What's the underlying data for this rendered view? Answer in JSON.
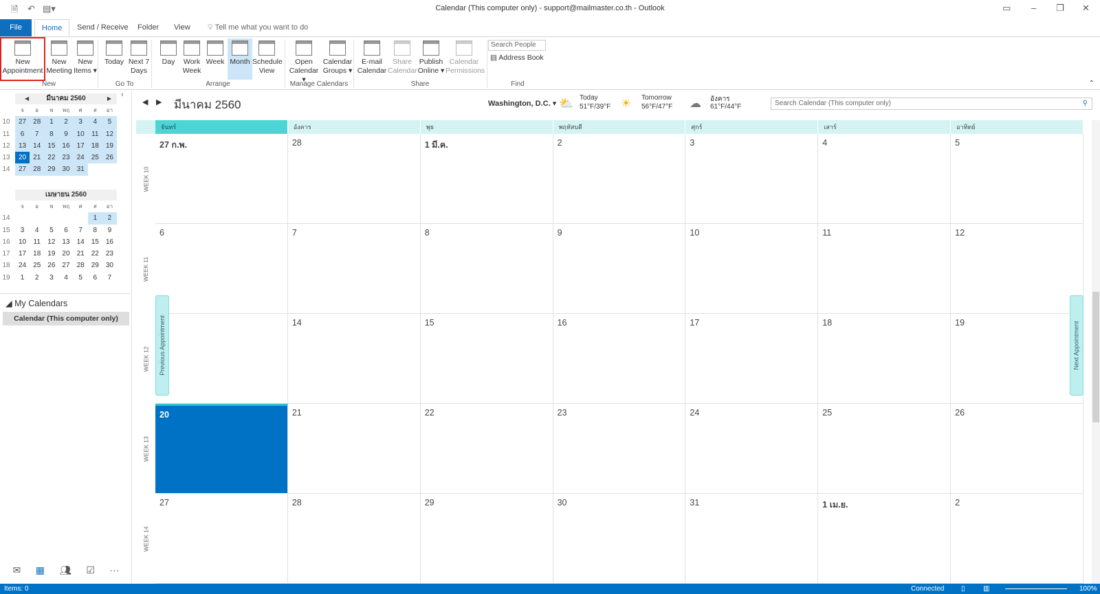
{
  "window": {
    "title": "Calendar (This computer only) - support@mailmaster.co.th  -  Outlook"
  },
  "tabs": [
    {
      "label": "File"
    },
    {
      "label": "Home"
    },
    {
      "label": "Send / Receive"
    },
    {
      "label": "Folder"
    },
    {
      "label": "View"
    }
  ],
  "tell_me": "Tell me what you want to do",
  "ribbon": {
    "buttons": [
      {
        "label": "New Appointment",
        "icon": "calendar-new-icon"
      },
      {
        "label": "New Meeting",
        "icon": "meeting-icon"
      },
      {
        "label": "New Items ▾",
        "icon": "new-items-icon"
      },
      {
        "label": "Today",
        "icon": "today-icon"
      },
      {
        "label": "Next 7 Days",
        "icon": "next-7-days-icon"
      },
      {
        "label": "Day",
        "icon": "day-view-icon"
      },
      {
        "label": "Work Week",
        "icon": "work-week-icon"
      },
      {
        "label": "Week",
        "icon": "week-view-icon"
      },
      {
        "label": "Month",
        "icon": "month-view-icon"
      },
      {
        "label": "Schedule View",
        "icon": "schedule-view-icon"
      },
      {
        "label": "Open Calendar ▾",
        "icon": "open-calendar-icon"
      },
      {
        "label": "Calendar Groups ▾",
        "icon": "calendar-groups-icon"
      },
      {
        "label": "E-mail Calendar",
        "icon": "email-calendar-icon"
      },
      {
        "label": "Share Calendar",
        "icon": "share-calendar-icon"
      },
      {
        "label": "Publish Online ▾",
        "icon": "publish-online-icon"
      },
      {
        "label": "Calendar Permissions",
        "icon": "permissions-icon"
      }
    ],
    "groups": [
      "New",
      "Go To",
      "Arrange",
      "Manage Calendars",
      "Share",
      "Find"
    ],
    "search_people_placeholder": "Search People",
    "address_book": "Address Book"
  },
  "mini_calendars": [
    {
      "title": "มีนาคม 2560",
      "dow": [
        "จ",
        "อ",
        "พ",
        "พฤ",
        "ศ",
        "ส",
        "อา"
      ],
      "weeks": [
        {
          "wk": "10",
          "days": [
            "27",
            "28",
            "1",
            "2",
            "3",
            "4",
            "5"
          ]
        },
        {
          "wk": "11",
          "days": [
            "6",
            "7",
            "8",
            "9",
            "10",
            "11",
            "12"
          ]
        },
        {
          "wk": "12",
          "days": [
            "13",
            "14",
            "15",
            "16",
            "17",
            "18",
            "19"
          ]
        },
        {
          "wk": "13",
          "days": [
            "20",
            "21",
            "22",
            "23",
            "24",
            "25",
            "26"
          ]
        },
        {
          "wk": "14",
          "days": [
            "27",
            "28",
            "29",
            "30",
            "31",
            "",
            ""
          ]
        }
      ]
    },
    {
      "title": "เมษายน 2560",
      "dow": [
        "จ",
        "อ",
        "พ",
        "พฤ",
        "ศ",
        "ส",
        "อา"
      ],
      "weeks": [
        {
          "wk": "14",
          "days": [
            "",
            "",
            "",
            "",
            "",
            "1",
            "2"
          ]
        },
        {
          "wk": "15",
          "days": [
            "3",
            "4",
            "5",
            "6",
            "7",
            "8",
            "9"
          ]
        },
        {
          "wk": "16",
          "days": [
            "10",
            "11",
            "12",
            "13",
            "14",
            "15",
            "16"
          ]
        },
        {
          "wk": "17",
          "days": [
            "17",
            "18",
            "19",
            "20",
            "21",
            "22",
            "23"
          ]
        },
        {
          "wk": "18",
          "days": [
            "24",
            "25",
            "26",
            "27",
            "28",
            "29",
            "30"
          ]
        },
        {
          "wk": "19",
          "days": [
            "1",
            "2",
            "3",
            "4",
            "5",
            "6",
            "7"
          ]
        }
      ]
    }
  ],
  "my_calendars": {
    "label": "My Calendars",
    "items": [
      "Calendar (This computer only)"
    ]
  },
  "calendar": {
    "title": "มีนาคม 2560",
    "location": "Washington, D.C.",
    "weather": [
      {
        "label": "Today",
        "temp": "51°F/39°F",
        "icon": "partly-sunny-icon"
      },
      {
        "label": "Tomorrow",
        "temp": "56°F/47°F",
        "icon": "sunny-icon"
      },
      {
        "label": "อังคาร",
        "temp": "61°F/44°F",
        "icon": "cloudy-icon"
      }
    ],
    "search_placeholder": "Search Calendar (This computer only)",
    "day_headers": [
      "จันทร์",
      "อังคาร",
      "พุธ",
      "พฤหัสบดี",
      "ศุกร์",
      "เสาร์",
      "อาทิตย์"
    ],
    "weeks": [
      {
        "label": "WEEK 10",
        "days": [
          "27 ก.พ.",
          "28",
          "1 มี.ค.",
          "2",
          "3",
          "4",
          "5"
        ]
      },
      {
        "label": "WEEK 11",
        "days": [
          "6",
          "7",
          "8",
          "9",
          "10",
          "11",
          "12"
        ]
      },
      {
        "label": "WEEK 12",
        "days": [
          "13",
          "14",
          "15",
          "16",
          "17",
          "18",
          "19"
        ]
      },
      {
        "label": "WEEK 13",
        "days": [
          "20",
          "21",
          "22",
          "23",
          "24",
          "25",
          "26"
        ]
      },
      {
        "label": "WEEK 14",
        "days": [
          "27",
          "28",
          "29",
          "30",
          "31",
          "1 เม.ย.",
          "2"
        ]
      }
    ],
    "today": "20",
    "previous_appointment": "Previous Appointment",
    "next_appointment": "Next Appointment"
  },
  "status": {
    "items": "Items: 0",
    "connection": "Connected",
    "zoom": "100%"
  },
  "colors": {
    "accent": "#0072c6",
    "header": "#d6f3f3",
    "selected_header": "#4dd5d5"
  }
}
